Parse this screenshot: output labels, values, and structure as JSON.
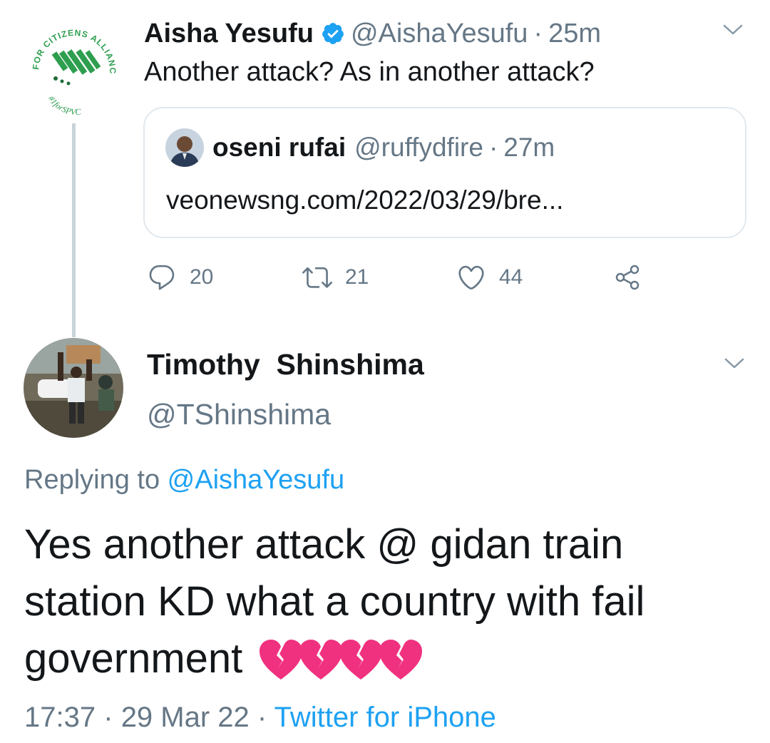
{
  "colors": {
    "text": "#14171a",
    "secondary": "#657786",
    "link": "#1da1f2",
    "verified": "#1da1f2",
    "border": "#e1e8ed",
    "thread_line": "#c9d3da",
    "logo_green": "#2e9e4f",
    "heart": "#f0317f"
  },
  "parent_tweet": {
    "avatar_logo": {
      "arc_text": "FOR CITIZENS ALLIANCE",
      "hashtag": "#1forSPVC"
    },
    "name": "Aisha Yesufu",
    "verified_icon": "verified-badge-icon",
    "handle": "@AishaYesufu",
    "separator": "·",
    "time": "25m",
    "text": "Another attack? As in another attack?",
    "quoted": {
      "name": "oseni rufai",
      "handle": "@ruffydfire",
      "separator": "·",
      "time": "27m",
      "text": "veonewsng.com/2022/03/29/bre..."
    },
    "actions": {
      "reply_count": "20",
      "retweet_count": "21",
      "like_count": "44",
      "icons": [
        "reply-icon",
        "retweet-icon",
        "like-icon",
        "share-icon"
      ]
    }
  },
  "reply_tweet": {
    "name": "Timothy  Shinshima",
    "handle": "@TShinshima",
    "replying_prefix": "Replying to ",
    "replying_to": "@AishaYesufu",
    "text": "Yes another attack @ gidan train station KD what a country with fail government",
    "emoji": "broken-heart-icon ×4",
    "time": "17:37",
    "separator": "·",
    "date": "29 Mar 22",
    "source": "Twitter for iPhone"
  }
}
